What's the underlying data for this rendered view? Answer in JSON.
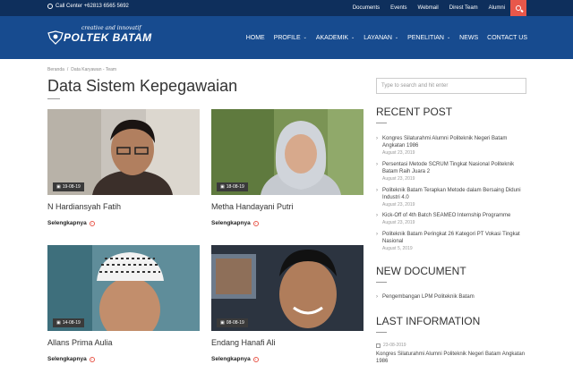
{
  "topbar": {
    "call_center": "Call Center +62813 6565 5692",
    "links": [
      "Documents",
      "Events",
      "Webmail",
      "Direst Team",
      "Alumni"
    ]
  },
  "header": {
    "tagline": "creative and innovatif",
    "logo_name": "POLTEK BATAM",
    "nav": [
      {
        "label": "HOME",
        "dropdown": false
      },
      {
        "label": "PROFILE",
        "dropdown": true
      },
      {
        "label": "AKADEMIK",
        "dropdown": true
      },
      {
        "label": "LAYANAN",
        "dropdown": true
      },
      {
        "label": "PENELITIAN",
        "dropdown": true
      },
      {
        "label": "NEWS",
        "dropdown": false
      },
      {
        "label": "CONTACT US",
        "dropdown": false
      }
    ]
  },
  "breadcrumb": {
    "home": "Beranda",
    "sep": "/",
    "current": "Data Karyawan - Team"
  },
  "page_title": "Data Sistem Kepegawaian",
  "read_more": "Selengkapnya",
  "cards": [
    {
      "name": "N Hardiansyah Fatih",
      "date": "19-08-19"
    },
    {
      "name": "Metha Handayani Putri",
      "date": "18-08-19"
    },
    {
      "name": "Allans Prima Aulia",
      "date": "14-08-19"
    },
    {
      "name": "Endang Hanafi Ali",
      "date": "08-08-19"
    }
  ],
  "sidebar": {
    "search_placeholder": "Type to search and hit enter",
    "recent_post_title": "RECENT POST",
    "recent_posts": [
      {
        "title": "Kongres Silaturahmi Alumni Politeknik Negeri Batam Angkatan 1986",
        "date": "August 23, 2019"
      },
      {
        "title": "Persentasi Metode SCRUM Tingkat Nasional Politeknik Batam Raih Juara 2",
        "date": "August 23, 2019"
      },
      {
        "title": "Politeknik Batam Terapkan Metode dalam Bersaing Diduni Industri 4.0",
        "date": "August 23, 2019"
      },
      {
        "title": "Kick-Off of 4th Batch SEAMEO Internship Programme",
        "date": "August 23, 2019"
      },
      {
        "title": "Politeknik Batam Peringkat 26 Kategori PT Vokasi Tingkat Nasional",
        "date": "August 5, 2019"
      }
    ],
    "new_document_title": "NEW DOCUMENT",
    "documents": [
      "Pengembangan LPM Politeknik Batam"
    ],
    "last_info_title": "LAST INFORMATION",
    "last_info": [
      {
        "date": "23-08-2019",
        "title": "Kongres Silaturahmi Alumni Politeknik Negeri Batam Angkatan 1986"
      }
    ]
  }
}
